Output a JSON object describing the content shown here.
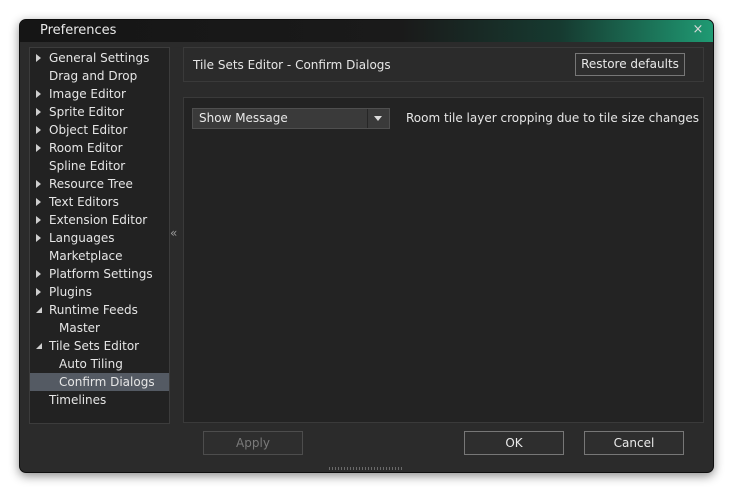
{
  "window": {
    "title": "Preferences",
    "close_label": "×"
  },
  "tree": {
    "items": [
      {
        "label": "General Settings",
        "arrow": "right",
        "indent": 0
      },
      {
        "label": "Drag and Drop",
        "arrow": "",
        "indent": 0
      },
      {
        "label": "Image Editor",
        "arrow": "right",
        "indent": 0
      },
      {
        "label": "Sprite Editor",
        "arrow": "right",
        "indent": 0
      },
      {
        "label": "Object Editor",
        "arrow": "right",
        "indent": 0
      },
      {
        "label": "Room Editor",
        "arrow": "right",
        "indent": 0
      },
      {
        "label": "Spline Editor",
        "arrow": "",
        "indent": 0
      },
      {
        "label": "Resource Tree",
        "arrow": "right",
        "indent": 0
      },
      {
        "label": "Text Editors",
        "arrow": "right",
        "indent": 0
      },
      {
        "label": "Extension Editor",
        "arrow": "right",
        "indent": 0
      },
      {
        "label": "Languages",
        "arrow": "right",
        "indent": 0
      },
      {
        "label": "Marketplace",
        "arrow": "",
        "indent": 0
      },
      {
        "label": "Platform Settings",
        "arrow": "right",
        "indent": 0
      },
      {
        "label": "Plugins",
        "arrow": "right",
        "indent": 0
      },
      {
        "label": "Runtime Feeds",
        "arrow": "down",
        "indent": 0
      },
      {
        "label": "Master",
        "arrow": "",
        "indent": 1
      },
      {
        "label": "Tile Sets Editor",
        "arrow": "down",
        "indent": 0
      },
      {
        "label": "Auto Tiling",
        "arrow": "",
        "indent": 1
      },
      {
        "label": "Confirm Dialogs",
        "arrow": "",
        "indent": 1,
        "selected": true
      },
      {
        "label": "Timelines",
        "arrow": "",
        "indent": 0
      }
    ],
    "collapse_label": "«"
  },
  "panel": {
    "title": "Tile Sets Editor - Confirm Dialogs",
    "restore_label": "Restore defaults",
    "option": {
      "selected_value": "Show Message",
      "description": "Room tile layer cropping due to tile size changes"
    }
  },
  "footer": {
    "apply_label": "Apply",
    "ok_label": "OK",
    "cancel_label": "Cancel"
  },
  "colors": {
    "accent_green": "#1f9a73",
    "selected_bg": "#545a63",
    "window_bg": "#2b2b2b"
  }
}
